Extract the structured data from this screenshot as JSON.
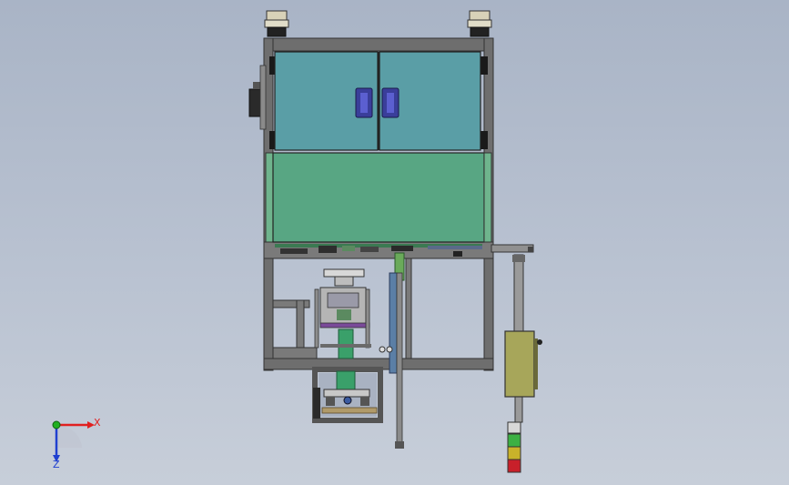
{
  "viewport": {
    "background": "#b3bccb"
  },
  "colors": {
    "frame": "#6e6e6e",
    "frame_dark": "#4a4a4a",
    "glass_cyan": "#5a9ea6",
    "glass_green": "#58a683",
    "handle": "#5b5fd0",
    "axis_x": "#e02020",
    "axis_y": "#20b020",
    "axis_z": "#2040d0",
    "controller_box": "#a7a65a",
    "light_green": "#3cb043",
    "light_yellow": "#c9b22a",
    "light_red": "#c8202a"
  },
  "triad": {
    "x_label": "X",
    "z_label": "Z"
  }
}
